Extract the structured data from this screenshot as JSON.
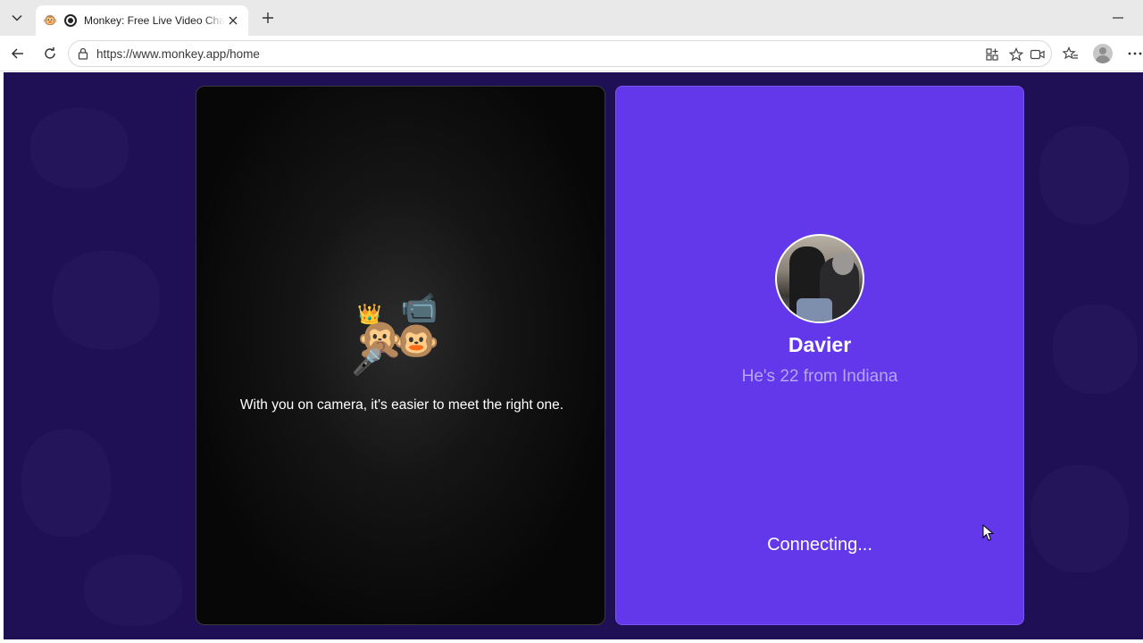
{
  "browser": {
    "tab": {
      "title": "Monkey: Free Live Video Chat",
      "favicon": "monkey-emoji",
      "favicon_glyph": "🐵"
    },
    "address_bar": {
      "url": "https://www.monkey.app/home"
    },
    "icons": [
      "tab-list-icon",
      "recording-icon",
      "close-icon",
      "new-tab-icon",
      "minimize-icon",
      "back-icon",
      "refresh-icon",
      "lock-icon",
      "app-available-icon",
      "favorite-star-icon",
      "video-icon",
      "favorites-icon",
      "profile-icon",
      "more-icon"
    ]
  },
  "page": {
    "background_color": "#1f0f55",
    "self_panel": {
      "message": "With you on camera, it's easier to meet the right one.",
      "emoji": {
        "crown": "👑",
        "monkey_singing": "🙊",
        "monkey": "🐵",
        "camera": "📹",
        "microphone": "🎤"
      }
    },
    "match_panel": {
      "accent_color": "#6338eb",
      "name": "Davier",
      "subtitle": "He's 22 from Indiana",
      "status": "Connecting..."
    }
  }
}
